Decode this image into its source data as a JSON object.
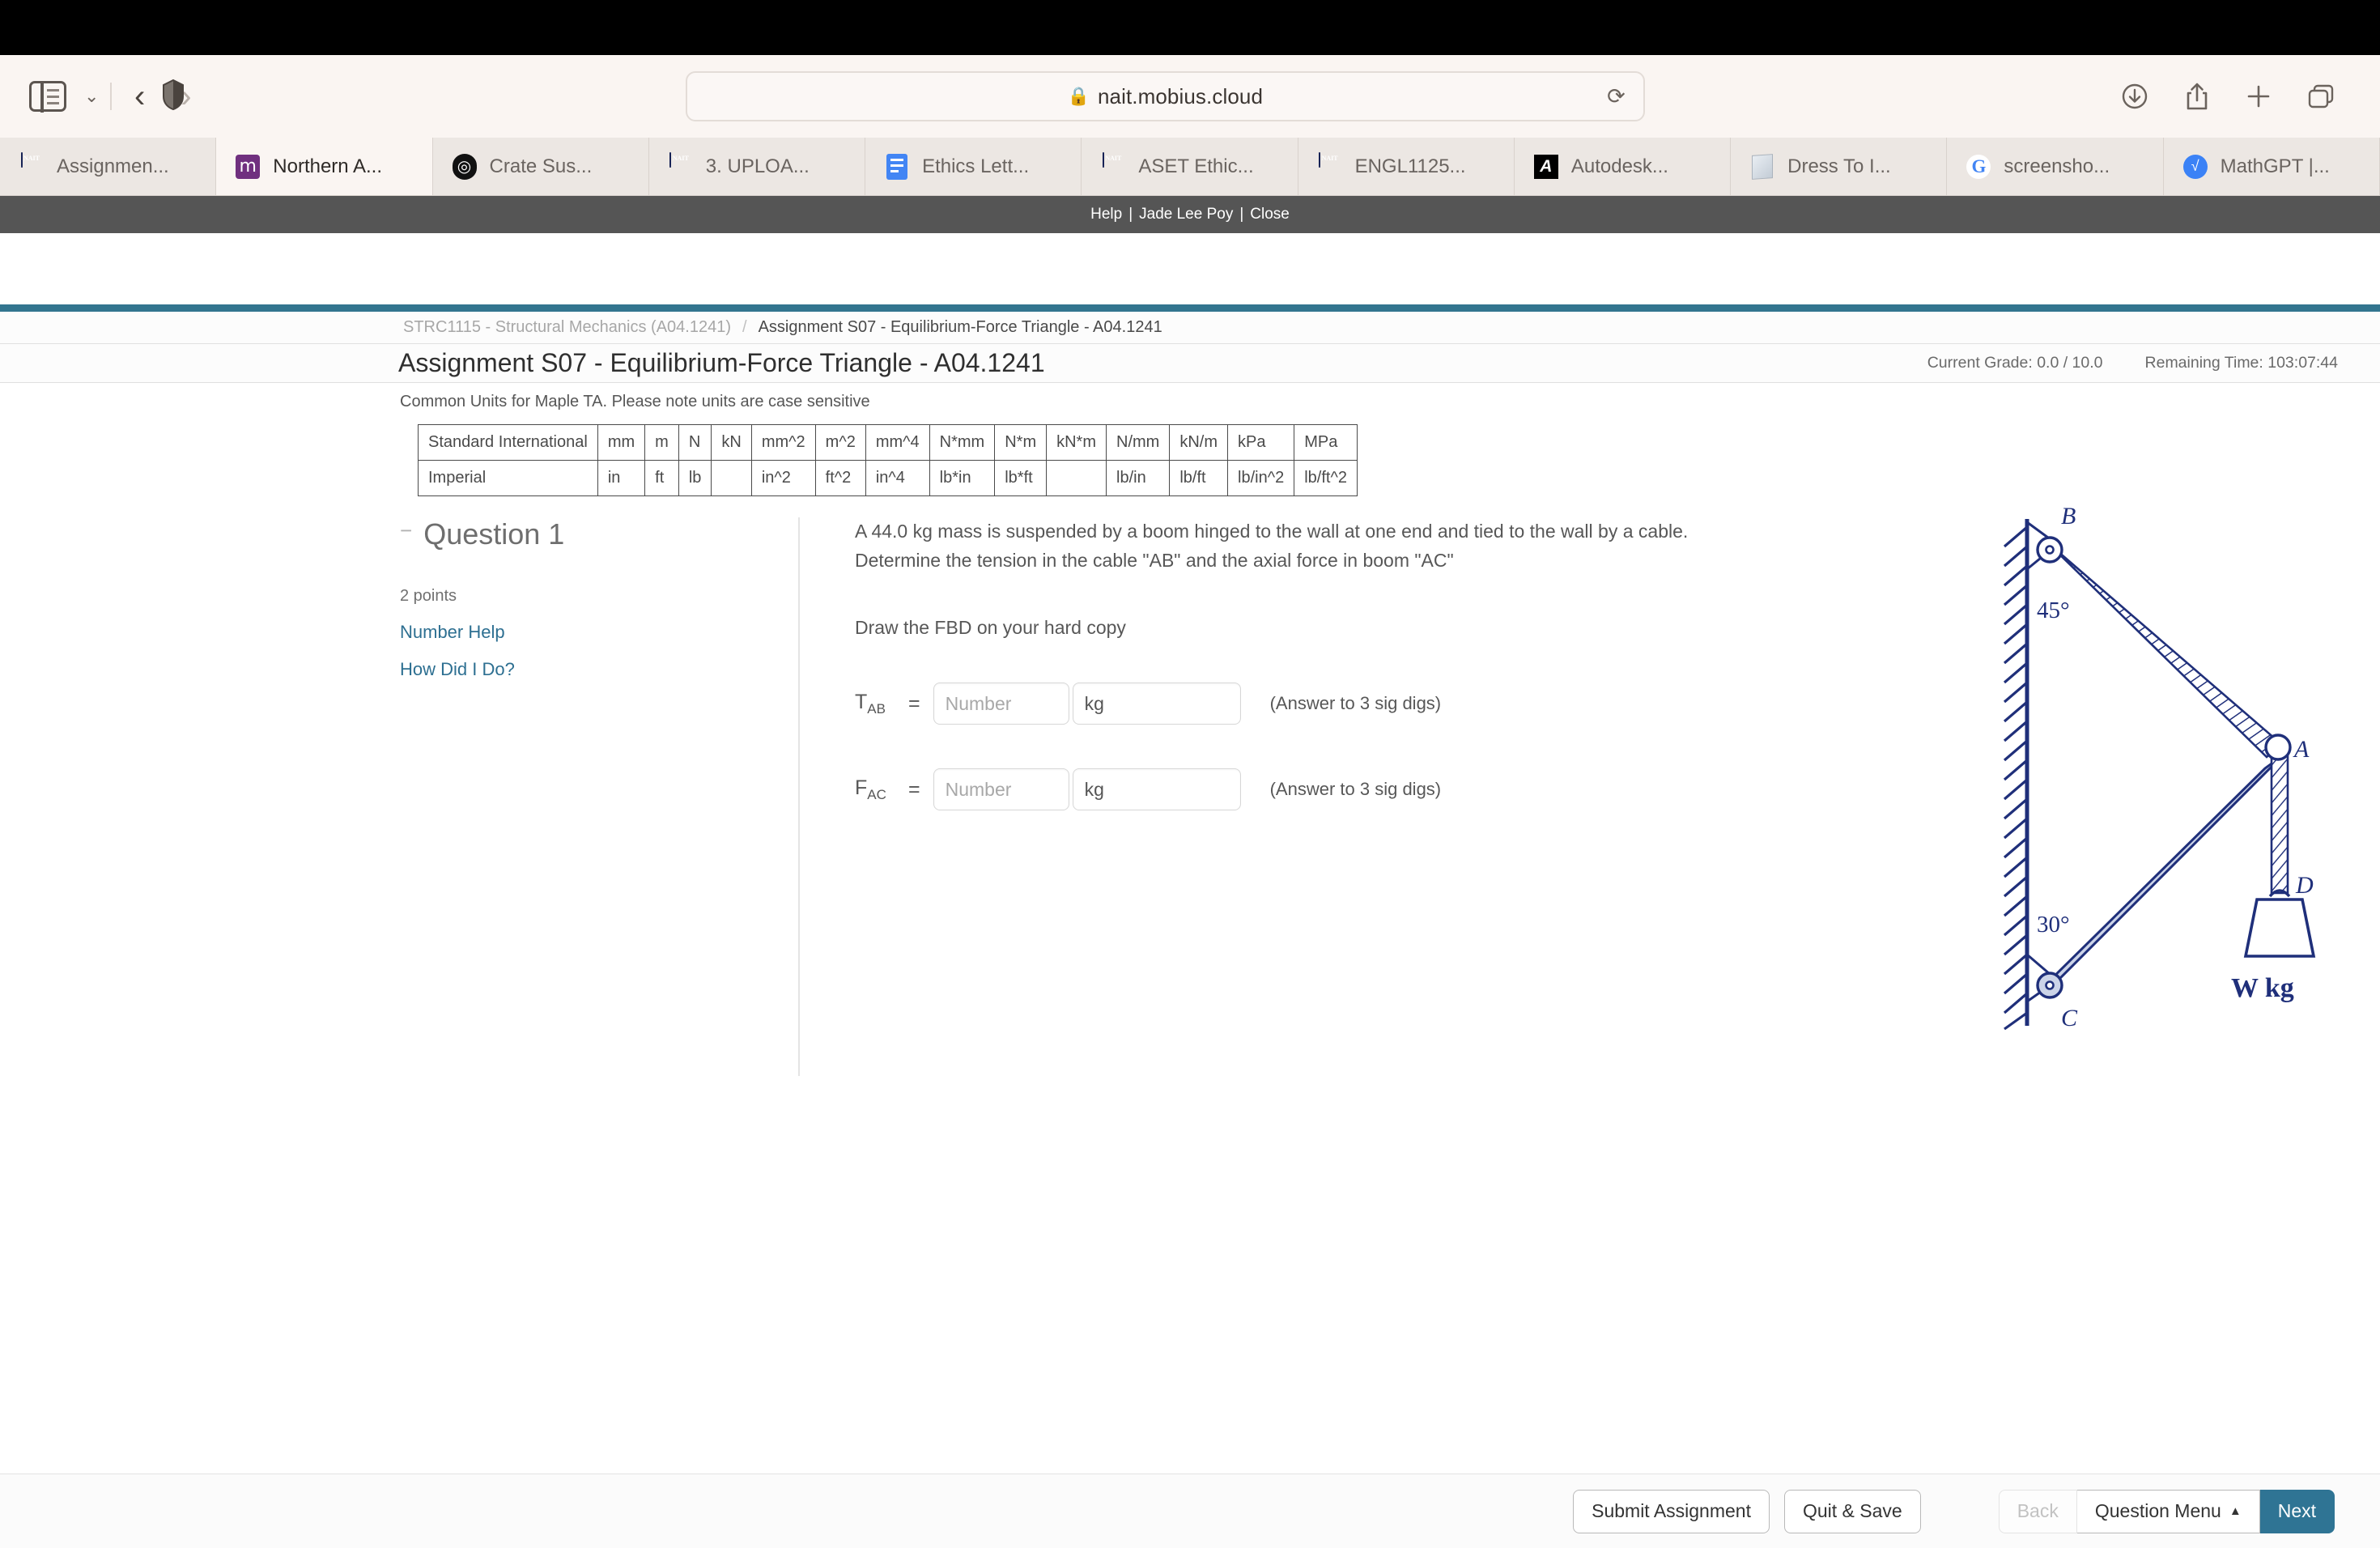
{
  "browser": {
    "url": "nait.mobius.cloud",
    "lock_icon": "lock-icon",
    "reload_icon": "reload-icon",
    "sidebar_icon": "sidebar-toggle-icon",
    "tab_group_chevron": "chevron-down-icon",
    "back_icon": "chevron-left-icon",
    "forward_icon": "chevron-right-icon",
    "shield_icon": "privacy-shield-icon",
    "downloads_icon": "download-icon",
    "share_icon": "share-icon",
    "new_tab_icon": "plus-icon",
    "tab_overview_icon": "tab-overview-icon",
    "tabs": [
      {
        "label": "Assignmen...",
        "favicon": "nait-shield-icon",
        "active": false
      },
      {
        "label": "Northern A...",
        "favicon": "mobius-m-icon",
        "active": true
      },
      {
        "label": "Crate Sus...",
        "favicon": "crate-icon",
        "active": false
      },
      {
        "label": "3. UPLOA...",
        "favicon": "nait-shield-icon",
        "active": false
      },
      {
        "label": "Ethics Lett...",
        "favicon": "google-docs-icon",
        "active": false
      },
      {
        "label": "ASET Ethic...",
        "favicon": "nait-shield-icon",
        "active": false
      },
      {
        "label": "ENGL1125...",
        "favicon": "nait-shield-icon",
        "active": false
      },
      {
        "label": "Autodesk...",
        "favicon": "autodesk-icon",
        "active": false
      },
      {
        "label": "Dress To I...",
        "favicon": "dress-icon",
        "active": false
      },
      {
        "label": "screensho...",
        "favicon": "google-icon",
        "active": false
      },
      {
        "label": "MathGPT |...",
        "favicon": "mathgpt-icon",
        "active": false
      }
    ]
  },
  "mobius_topbar": {
    "help": "Help",
    "user": "Jade Lee Poy",
    "close": "Close",
    "separator": "|"
  },
  "breadcrumb": {
    "course": "STRC1115 - Structural Mechanics (A04.1241)",
    "separator": "/",
    "current": "Assignment S07 - Equilibrium-Force Triangle - A04.1241"
  },
  "header": {
    "title": "Assignment S07 - Equilibrium-Force Triangle - A04.1241",
    "current_grade": "Current Grade: 0.0 / 10.0",
    "remaining_time": "Remaining Time:  103:07:44"
  },
  "units_note": "Common Units for Maple TA. Please note units are case sensitive",
  "units_table": {
    "rows": [
      {
        "head": "Standard International",
        "cells": [
          "mm",
          "m",
          "N",
          "kN",
          "mm^2",
          "m^2",
          "mm^4",
          "N*mm",
          "N*m",
          "kN*m",
          "N/mm",
          "kN/m",
          "kPa",
          "MPa"
        ]
      },
      {
        "head": "Imperial",
        "cells": [
          "in",
          "ft",
          "lb",
          "",
          "in^2",
          "ft^2",
          "in^4",
          "lb*in",
          "lb*ft",
          "",
          "lb/in",
          "lb/ft",
          "lb/in^2",
          "lb/ft^2"
        ]
      }
    ]
  },
  "question": {
    "collapse_glyph": "−",
    "title": "Question 1",
    "points": "2 points",
    "links": [
      "Number Help",
      "How Did I Do?"
    ],
    "prompt": "A  44.0 kg  mass is suspended by a boom hinged to the wall at one end and tied to the wall by a cable. Determine the tension in the cable  \"AB\" and the axial force in boom \"AC\"",
    "sub_prompt": "Draw the FBD on your hard copy",
    "answers": [
      {
        "symbol": "T",
        "subscript": "AB",
        "equals": "=",
        "value": "",
        "placeholder": "Number",
        "unit": "kg",
        "hint": "(Answer to 3 sig digs)"
      },
      {
        "symbol": "F",
        "subscript": "AC",
        "equals": "=",
        "value": "",
        "placeholder": "Number",
        "unit": "kg",
        "hint": "(Answer to 3 sig digs)"
      }
    ]
  },
  "figure": {
    "name": "boom-and-cable-free-body-diagram",
    "labels": {
      "B": "B",
      "A": "A",
      "C": "C",
      "D": "D",
      "angle_top": "45°",
      "angle_bottom": "30°",
      "weight": "W kg"
    },
    "colors": {
      "ink": "#1f2f7a",
      "fill": "#ccd4e8"
    }
  },
  "actions": {
    "submit": "Submit Assignment",
    "quit_save": "Quit & Save",
    "back": "Back",
    "question_menu": "Question Menu",
    "question_menu_caret": "▲",
    "next": "Next"
  },
  "colors": {
    "teal_rule": "#33758f",
    "primary_button": "#2f7494",
    "link": "#2d6f91",
    "topbar": "#555555"
  }
}
